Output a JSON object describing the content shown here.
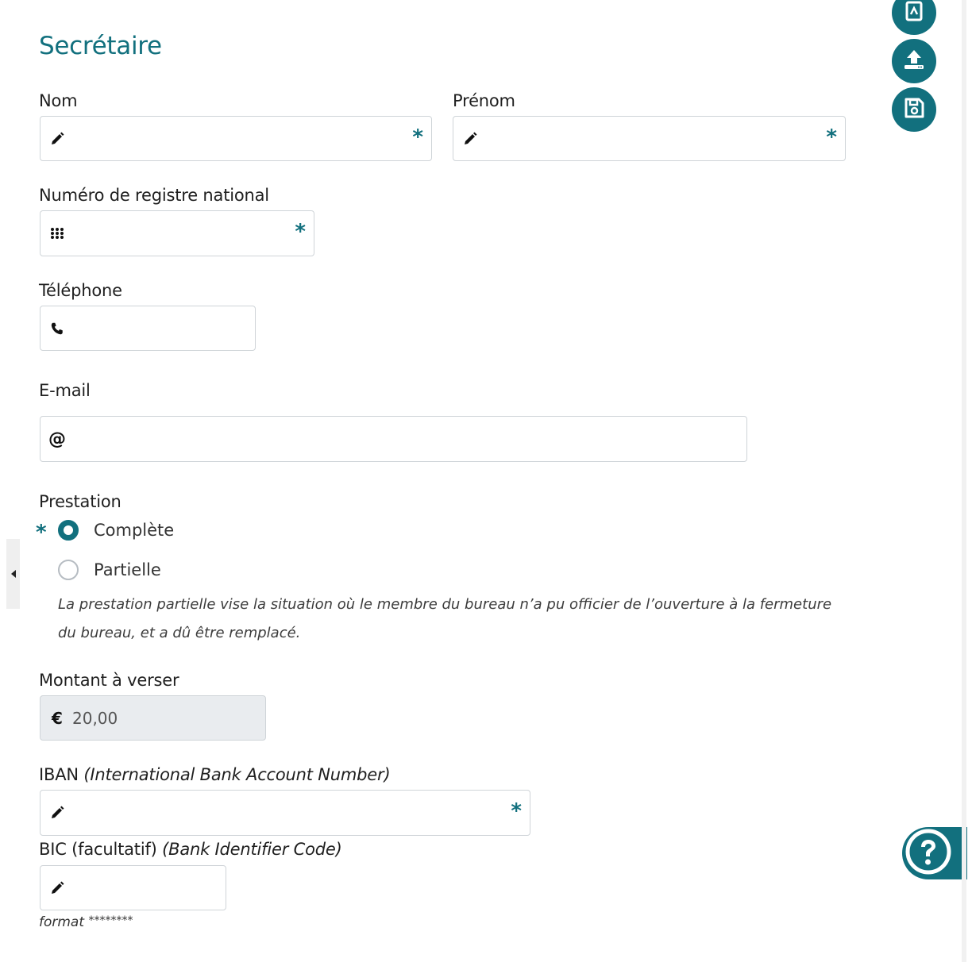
{
  "section_title": "Secrétaire",
  "fields": {
    "nom": {
      "label": "Nom",
      "value": "",
      "required_mark": "*",
      "icon": "pencil-icon"
    },
    "prenom": {
      "label": "Prénom",
      "value": "",
      "required_mark": "*",
      "icon": "pencil-icon"
    },
    "registre": {
      "label": "Numéro de registre national",
      "value": "",
      "required_mark": "*",
      "icon": "keypad-icon"
    },
    "telephone": {
      "label": "Téléphone",
      "value": "",
      "icon": "phone-icon"
    },
    "email": {
      "label": "E-mail",
      "value": "",
      "icon_text": "@"
    },
    "montant": {
      "label": "Montant à verser",
      "value": "20,00",
      "icon_text": "€"
    },
    "iban": {
      "label": "IBAN",
      "label_italic": "(International Bank Account Number)",
      "value": "",
      "required_mark": "*",
      "icon": "pencil-icon"
    },
    "bic": {
      "label": "BIC (facultatif)",
      "label_italic": "(Bank Identifier Code)",
      "value": "",
      "icon": "pencil-icon",
      "hint_italic": "format",
      "hint_mask": "********"
    }
  },
  "prestation": {
    "label": "Prestation",
    "required_mark": "*",
    "options": [
      {
        "label": "Complète",
        "checked": true
      },
      {
        "label": "Partielle",
        "checked": false
      }
    ],
    "note": "La prestation partielle vise la situation où le membre du bureau n’a pu officier de l’ouverture à la fermeture du bureau, et a dû être remplacé."
  },
  "actions": {
    "pdf_icon": "pdf-icon",
    "upload_icon": "upload-icon",
    "save_icon": "save-icon",
    "help_icon": "help-icon"
  },
  "colors": {
    "accent": "#12707e",
    "border": "#cfd4d8",
    "disabled_bg": "#e9ecef"
  }
}
